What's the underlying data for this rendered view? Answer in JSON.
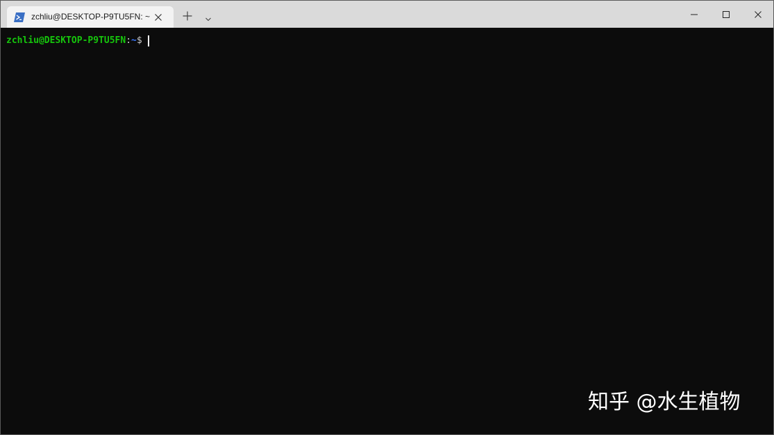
{
  "tab": {
    "title": "zchliu@DESKTOP-P9TU5FN: ~",
    "icon": "powershell-icon"
  },
  "controls": {
    "new_tab_icon": "plus-icon",
    "dropdown_icon": "chevron-down-icon",
    "minimize_icon": "minimize-icon",
    "maximize_icon": "maximize-icon",
    "close_icon": "close-icon"
  },
  "terminal": {
    "user_host": "zchliu@DESKTOP-P9TU5FN",
    "colon": ":",
    "path": "~",
    "dollar": "$",
    "colors": {
      "background": "#0c0c0c",
      "user_host": "#16c60c",
      "path": "#3b78ff",
      "text": "#cccccc"
    }
  },
  "watermark": {
    "text": "知乎 @水生植物"
  }
}
